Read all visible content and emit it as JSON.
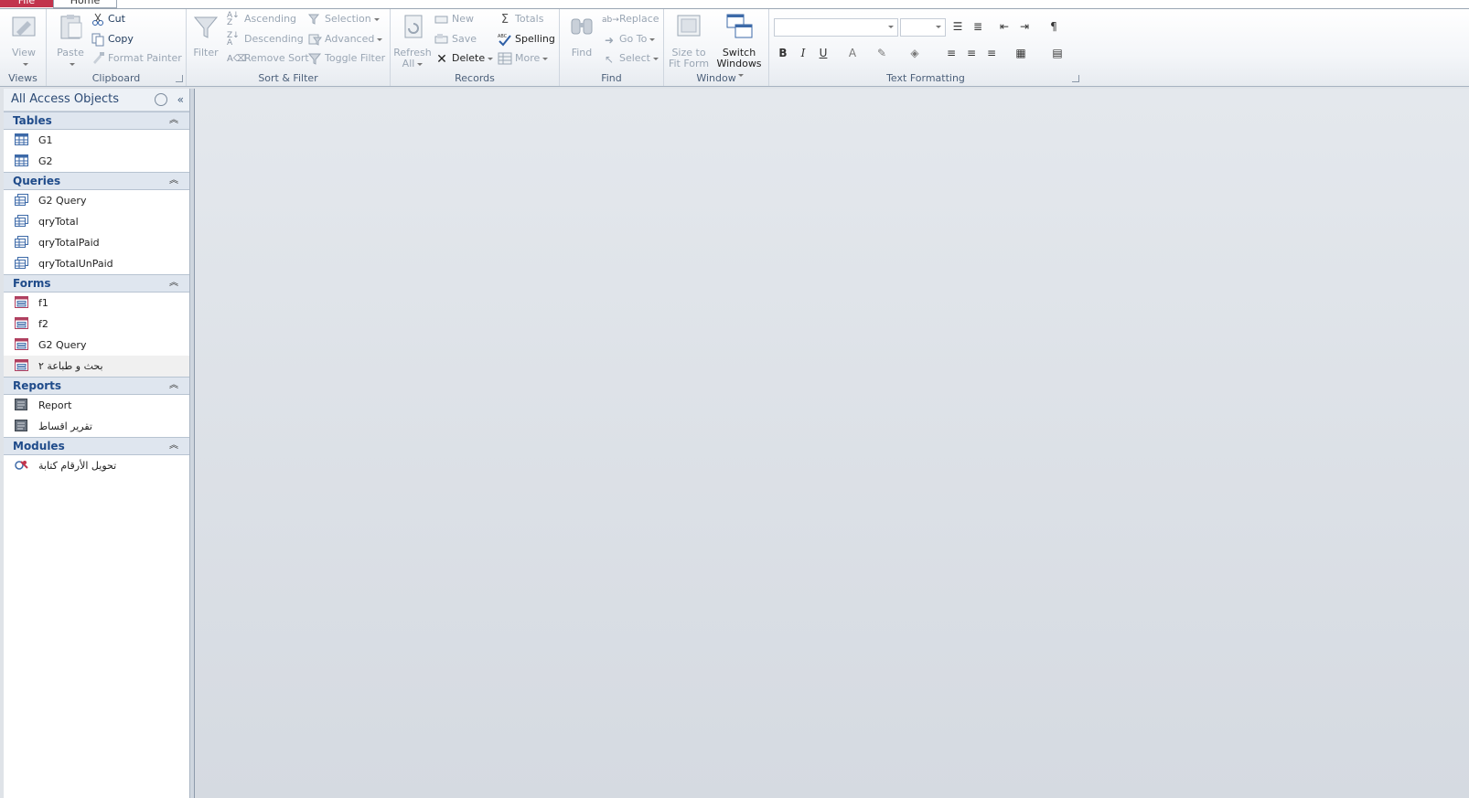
{
  "tabs": {
    "file": "File",
    "home": "Home"
  },
  "ribbon": {
    "views": {
      "label": "Views",
      "view": "View"
    },
    "clipboard": {
      "label": "Clipboard",
      "paste": "Paste",
      "cut": "Cut",
      "copy": "Copy",
      "format_painter": "Format Painter"
    },
    "sort_filter": {
      "label": "Sort & Filter",
      "filter": "Filter",
      "ascending": "Ascending",
      "descending": "Descending",
      "remove_sort": "Remove Sort",
      "selection": "Selection",
      "advanced": "Advanced",
      "toggle_filter": "Toggle Filter"
    },
    "records": {
      "label": "Records",
      "refresh_line1": "Refresh",
      "refresh_line2": "All",
      "new": "New",
      "save": "Save",
      "delete": "Delete",
      "totals": "Totals",
      "spelling": "Spelling",
      "more": "More"
    },
    "find": {
      "label": "Find",
      "find": "Find",
      "replace": "Replace",
      "go_to": "Go To",
      "select": "Select"
    },
    "window": {
      "label": "Window",
      "size_line1": "Size to",
      "size_line2": "Fit Form",
      "switch_line1": "Switch",
      "switch_line2": "Windows"
    },
    "text_formatting": {
      "label": "Text Formatting",
      "bold": "B",
      "italic": "I",
      "underline": "U",
      "font_color": "A"
    }
  },
  "nav": {
    "title": "All Access Objects",
    "sections": {
      "tables": {
        "title": "Tables",
        "items": [
          "G1",
          "G2"
        ]
      },
      "queries": {
        "title": "Queries",
        "items": [
          "G2 Query",
          "qryTotal",
          "qryTotalPaid",
          "qryTotalUnPaid"
        ]
      },
      "forms": {
        "title": "Forms",
        "items": [
          "f1",
          "f2",
          "G2 Query",
          "بحث و طباعة ٢"
        ]
      },
      "reports": {
        "title": "Reports",
        "items": [
          "Report",
          "تقرير اقساط"
        ]
      },
      "modules": {
        "title": "Modules",
        "items": [
          "تحويل الأرقام كتابة"
        ]
      }
    }
  },
  "colors": {
    "file_tab": "#c2344d",
    "accent": "#1f4b8a",
    "workspace": "#dfe3e8"
  },
  "icons": {
    "view": "view-icon",
    "paste": "clipboard-icon",
    "cut": "scissors-icon",
    "copy": "copy-icon",
    "format_painter": "paintbrush-icon",
    "filter": "funnel-icon",
    "table": "table-icon",
    "query": "query-icon",
    "form": "form-icon",
    "report": "report-icon",
    "module": "module-icon"
  }
}
